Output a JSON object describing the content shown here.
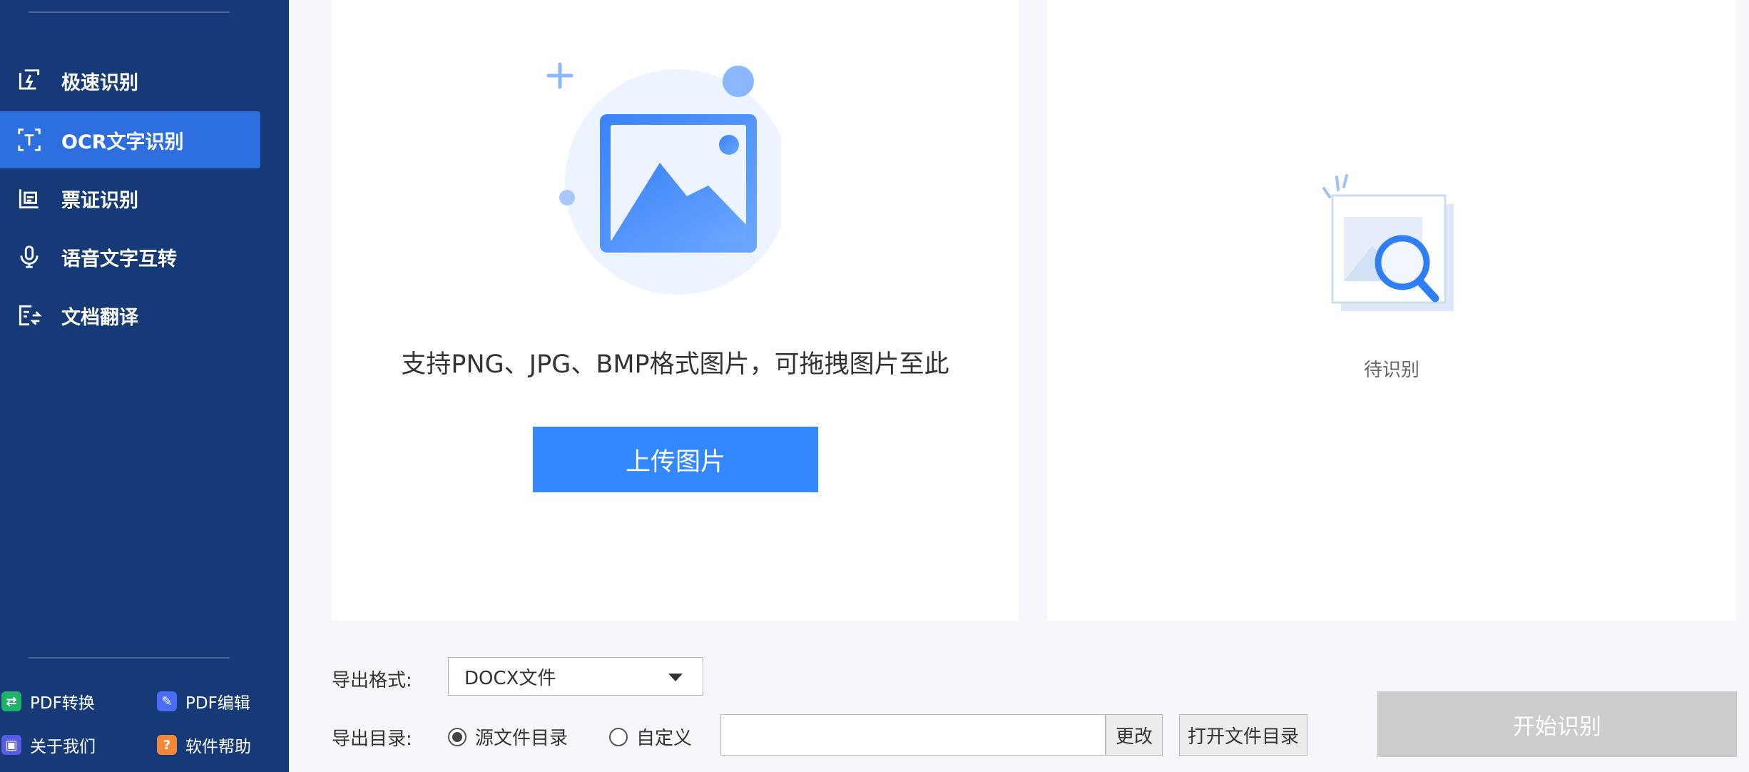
{
  "sidebar": {
    "nav": [
      {
        "label": "极速识别",
        "icon": "fast-recognize-icon"
      },
      {
        "label": "OCR文字识别",
        "icon": "ocr-scan-icon",
        "active": true
      },
      {
        "label": "票证识别",
        "icon": "ticket-icon"
      },
      {
        "label": "语音文字互转",
        "icon": "microphone-icon"
      },
      {
        "label": "文档翻译",
        "icon": "document-translate-icon"
      }
    ],
    "footer": [
      {
        "label": "PDF转换",
        "icon": "pdf-convert-icon",
        "color": "#1fb26b"
      },
      {
        "label": "PDF编辑",
        "icon": "pdf-edit-icon",
        "color": "#4a6cf7"
      },
      {
        "label": "关于我们",
        "icon": "about-icon",
        "color": "#5b5ce6"
      },
      {
        "label": "软件帮助",
        "icon": "help-icon",
        "color": "#f0873a"
      }
    ],
    "background": "#163a78",
    "active_color": "#2e6fe0"
  },
  "upload": {
    "hint": "支持PNG、JPG、BMP格式图片，可拖拽图片至此",
    "button": "上传图片",
    "accent": "#3388ff"
  },
  "result": {
    "status": "待识别"
  },
  "export": {
    "format_label": "导出格式:",
    "format_value": "DOCX文件",
    "dir_label": "导出目录:",
    "radio_source": "源文件目录",
    "radio_custom": "自定义",
    "path_value": "",
    "change_button": "更改",
    "open_dir_button": "打开文件目录",
    "start_button": "开始识别"
  }
}
